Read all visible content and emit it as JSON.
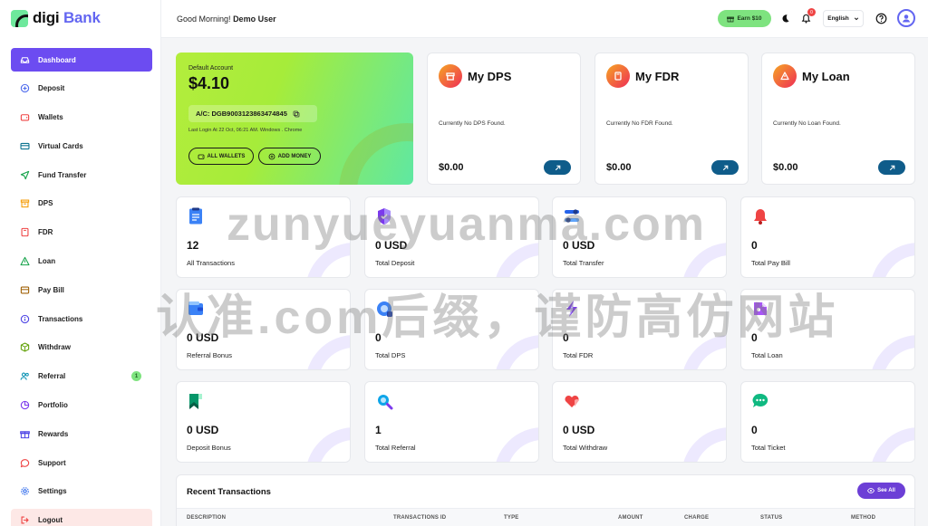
{
  "brand": {
    "name": "digi",
    "name_accent": " Bank"
  },
  "sidebar": {
    "items": [
      {
        "label": "Dashboard",
        "icon": "dashboard-icon"
      },
      {
        "label": "Deposit",
        "icon": "plus-circle-icon"
      },
      {
        "label": "Wallets",
        "icon": "wallet-icon"
      },
      {
        "label": "Virtual Cards",
        "icon": "credit-card-icon"
      },
      {
        "label": "Fund Transfer",
        "icon": "send-icon"
      },
      {
        "label": "DPS",
        "icon": "archive-icon"
      },
      {
        "label": "FDR",
        "icon": "book-icon"
      },
      {
        "label": "Loan",
        "icon": "alert-triangle-icon"
      },
      {
        "label": "Pay Bill",
        "icon": "bill-icon"
      },
      {
        "label": "Transactions",
        "icon": "info-circle-icon"
      },
      {
        "label": "Withdraw",
        "icon": "box-icon"
      },
      {
        "label": "Referral",
        "icon": "users-icon",
        "badge": "1"
      },
      {
        "label": "Portfolio",
        "icon": "chart-icon"
      },
      {
        "label": "Rewards",
        "icon": "gift-icon"
      },
      {
        "label": "Support",
        "icon": "chat-icon"
      },
      {
        "label": "Settings",
        "icon": "gear-icon"
      },
      {
        "label": "Logout",
        "icon": "logout-icon"
      }
    ]
  },
  "header": {
    "greeting": "Good Morning!",
    "user": "Demo User",
    "earn_label": "Earn $10",
    "notification_count": "0",
    "language": "English"
  },
  "account": {
    "label": "Default Account",
    "balance": "$4.10",
    "account_no": "A/C: DGB9003123863474845",
    "last_login": "Last Login At 22 Oct, 06:21 AM. Windows . Chrome",
    "all_wallets": "ALL WALLETS",
    "add_money": "ADD MONEY"
  },
  "products": [
    {
      "title": "My DPS",
      "message": "Currently No DPS Found.",
      "amount": "$0.00"
    },
    {
      "title": "My FDR",
      "message": "Currently No FDR Found.",
      "amount": "$0.00"
    },
    {
      "title": "My Loan",
      "message": "Currently No Loan Found.",
      "amount": "$0.00"
    }
  ],
  "stats": [
    {
      "value": "12",
      "label": "All Transactions"
    },
    {
      "value": "0 USD",
      "label": "Total Deposit"
    },
    {
      "value": "0 USD",
      "label": "Total Transfer"
    },
    {
      "value": "0",
      "label": "Total Pay Bill"
    },
    {
      "value": "0 USD",
      "label": "Referral Bonus"
    },
    {
      "value": "0",
      "label": "Total DPS"
    },
    {
      "value": "0",
      "label": "Total FDR"
    },
    {
      "value": "0",
      "label": "Total Loan"
    },
    {
      "value": "0 USD",
      "label": "Deposit Bonus"
    },
    {
      "value": "1",
      "label": "Total Referral"
    },
    {
      "value": "0 USD",
      "label": "Total Withdraw"
    },
    {
      "value": "0",
      "label": "Total Ticket"
    }
  ],
  "recent": {
    "title": "Recent Transactions",
    "see_all": "See All",
    "columns": [
      "DESCRIPTION",
      "TRANSACTIONS ID",
      "TYPE",
      "AMOUNT",
      "CHARGE",
      "STATUS",
      "METHOD"
    ]
  },
  "watermark": {
    "line1": "zunyueyuanma.com",
    "line2": "认准.com后缀，谨防高仿网站"
  }
}
